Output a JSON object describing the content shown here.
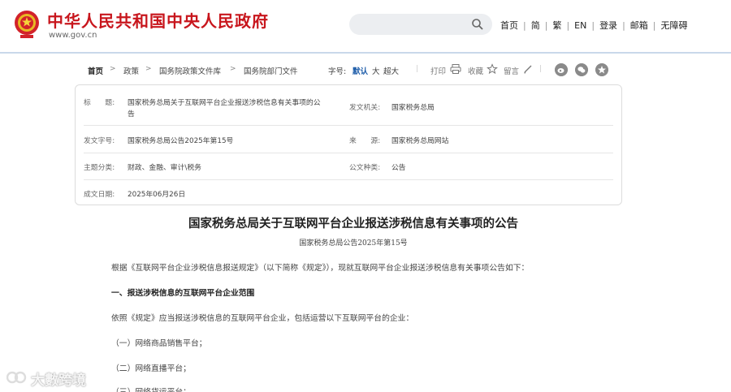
{
  "header": {
    "site_title": "中华人民共和国中央人民政府",
    "site_url": "www.gov.cn",
    "search_placeholder": "",
    "nav": [
      "首页",
      "简",
      "繁",
      "EN",
      "登录",
      "邮箱",
      "无障碍"
    ]
  },
  "breadcrumb": {
    "items": [
      "首页",
      "政策",
      "国务院政策文件库",
      "国务院部门文件"
    ],
    "font_size_label": "字号:",
    "font_sizes": [
      "默认",
      "大",
      "超大"
    ],
    "tools": [
      "打印",
      "收藏",
      "留言"
    ]
  },
  "info": {
    "title_label": "标　　题:",
    "title_value_line1": "国家税务总局关于互联网平台企业报送涉税信息有关事项的公",
    "title_value_line2": "告",
    "issuer_label": "发文机关:",
    "issuer_value": "国家税务总局",
    "docno_label": "发文字号:",
    "docno_value": "国家税务总局公告2025年第15号",
    "source_label": "来　　源:",
    "source_value": "国家税务总局网站",
    "topic_label": "主题分类:",
    "topic_value": "财政、金融、审计\\税务",
    "type_label": "公文种类:",
    "type_value": "公告",
    "date_label": "成文日期:",
    "date_value": "2025年06月26日"
  },
  "article": {
    "title": "国家税务总局关于互联网平台企业报送涉税信息有关事项的公告",
    "subtitle": "国家税务总局公告2025年第15号",
    "paragraphs": [
      "根据《互联网平台企业涉税信息报送规定》（以下简称《规定》），现就互联网平台企业报送涉税信息有关事项公告如下：",
      "一、报送涉税信息的互联网平台企业范围",
      "依照《规定》应当报送涉税信息的互联网平台企业，包括运营以下互联网平台的企业：",
      "（一）网络商品销售平台；",
      "（二）网络直播平台；",
      "（三）网络货运平台；"
    ]
  },
  "watermark": {
    "text": "大數跨境"
  },
  "colors": {
    "brand_red": "#c8161d",
    "link_blue": "#1a5aa8",
    "header_line": "#c9d8ea"
  }
}
